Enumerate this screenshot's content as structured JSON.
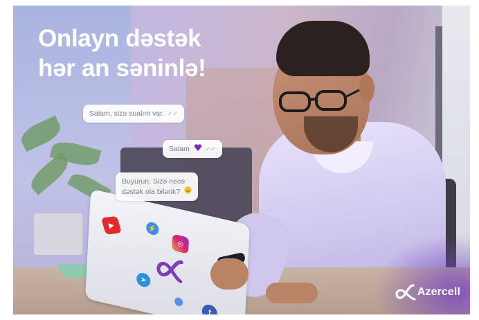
{
  "headline": {
    "line1": "Onlayn dəstək",
    "line2": "hər an səninlə!"
  },
  "chat": {
    "bubble1": {
      "text": "Salam, sizə sualım var.",
      "tick": "✓✓"
    },
    "bubble2": {
      "text": "Salam",
      "emoji": "purple-heart-emoji",
      "tick": "✓✓"
    },
    "bubble3": {
      "line1": "Buyurun, Sizə necə",
      "line2": "dəstək ola bilərik?",
      "emoji": "smile-emoji"
    }
  },
  "brand": {
    "name": "Azercell",
    "logo_icon": "azercell-alpha-logo",
    "accent_color": "#7b3fb8"
  },
  "laptop_stickers": [
    "youtube-icon",
    "messenger-icon",
    "instagram-icon",
    "alpha-icon",
    "telegram-icon",
    "facebook-icon",
    "small-badge-icon"
  ]
}
